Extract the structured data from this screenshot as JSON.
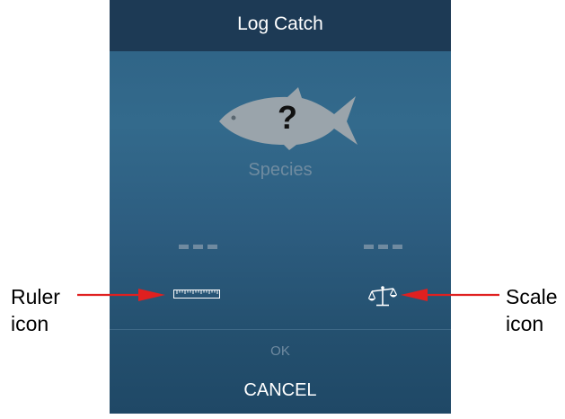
{
  "header": {
    "title": "Log Catch"
  },
  "catch": {
    "species_placeholder": "Species",
    "species_icon_glyph": "?",
    "length_value": "---",
    "weight_value": "---"
  },
  "actions": {
    "ok_label": "OK",
    "cancel_label": "CANCEL"
  },
  "annotations": {
    "ruler_line1": "Ruler",
    "ruler_line2": "icon",
    "scale_line1": "Scale",
    "scale_line2": "icon"
  },
  "icons": {
    "fish": "fish-icon",
    "ruler": "ruler-icon",
    "scale": "scale-icon"
  },
  "colors": {
    "header_bg": "#1d3a55",
    "panel_bg": "#2e6184",
    "fish": "#9aa4ab",
    "arrow": "#e02020"
  }
}
